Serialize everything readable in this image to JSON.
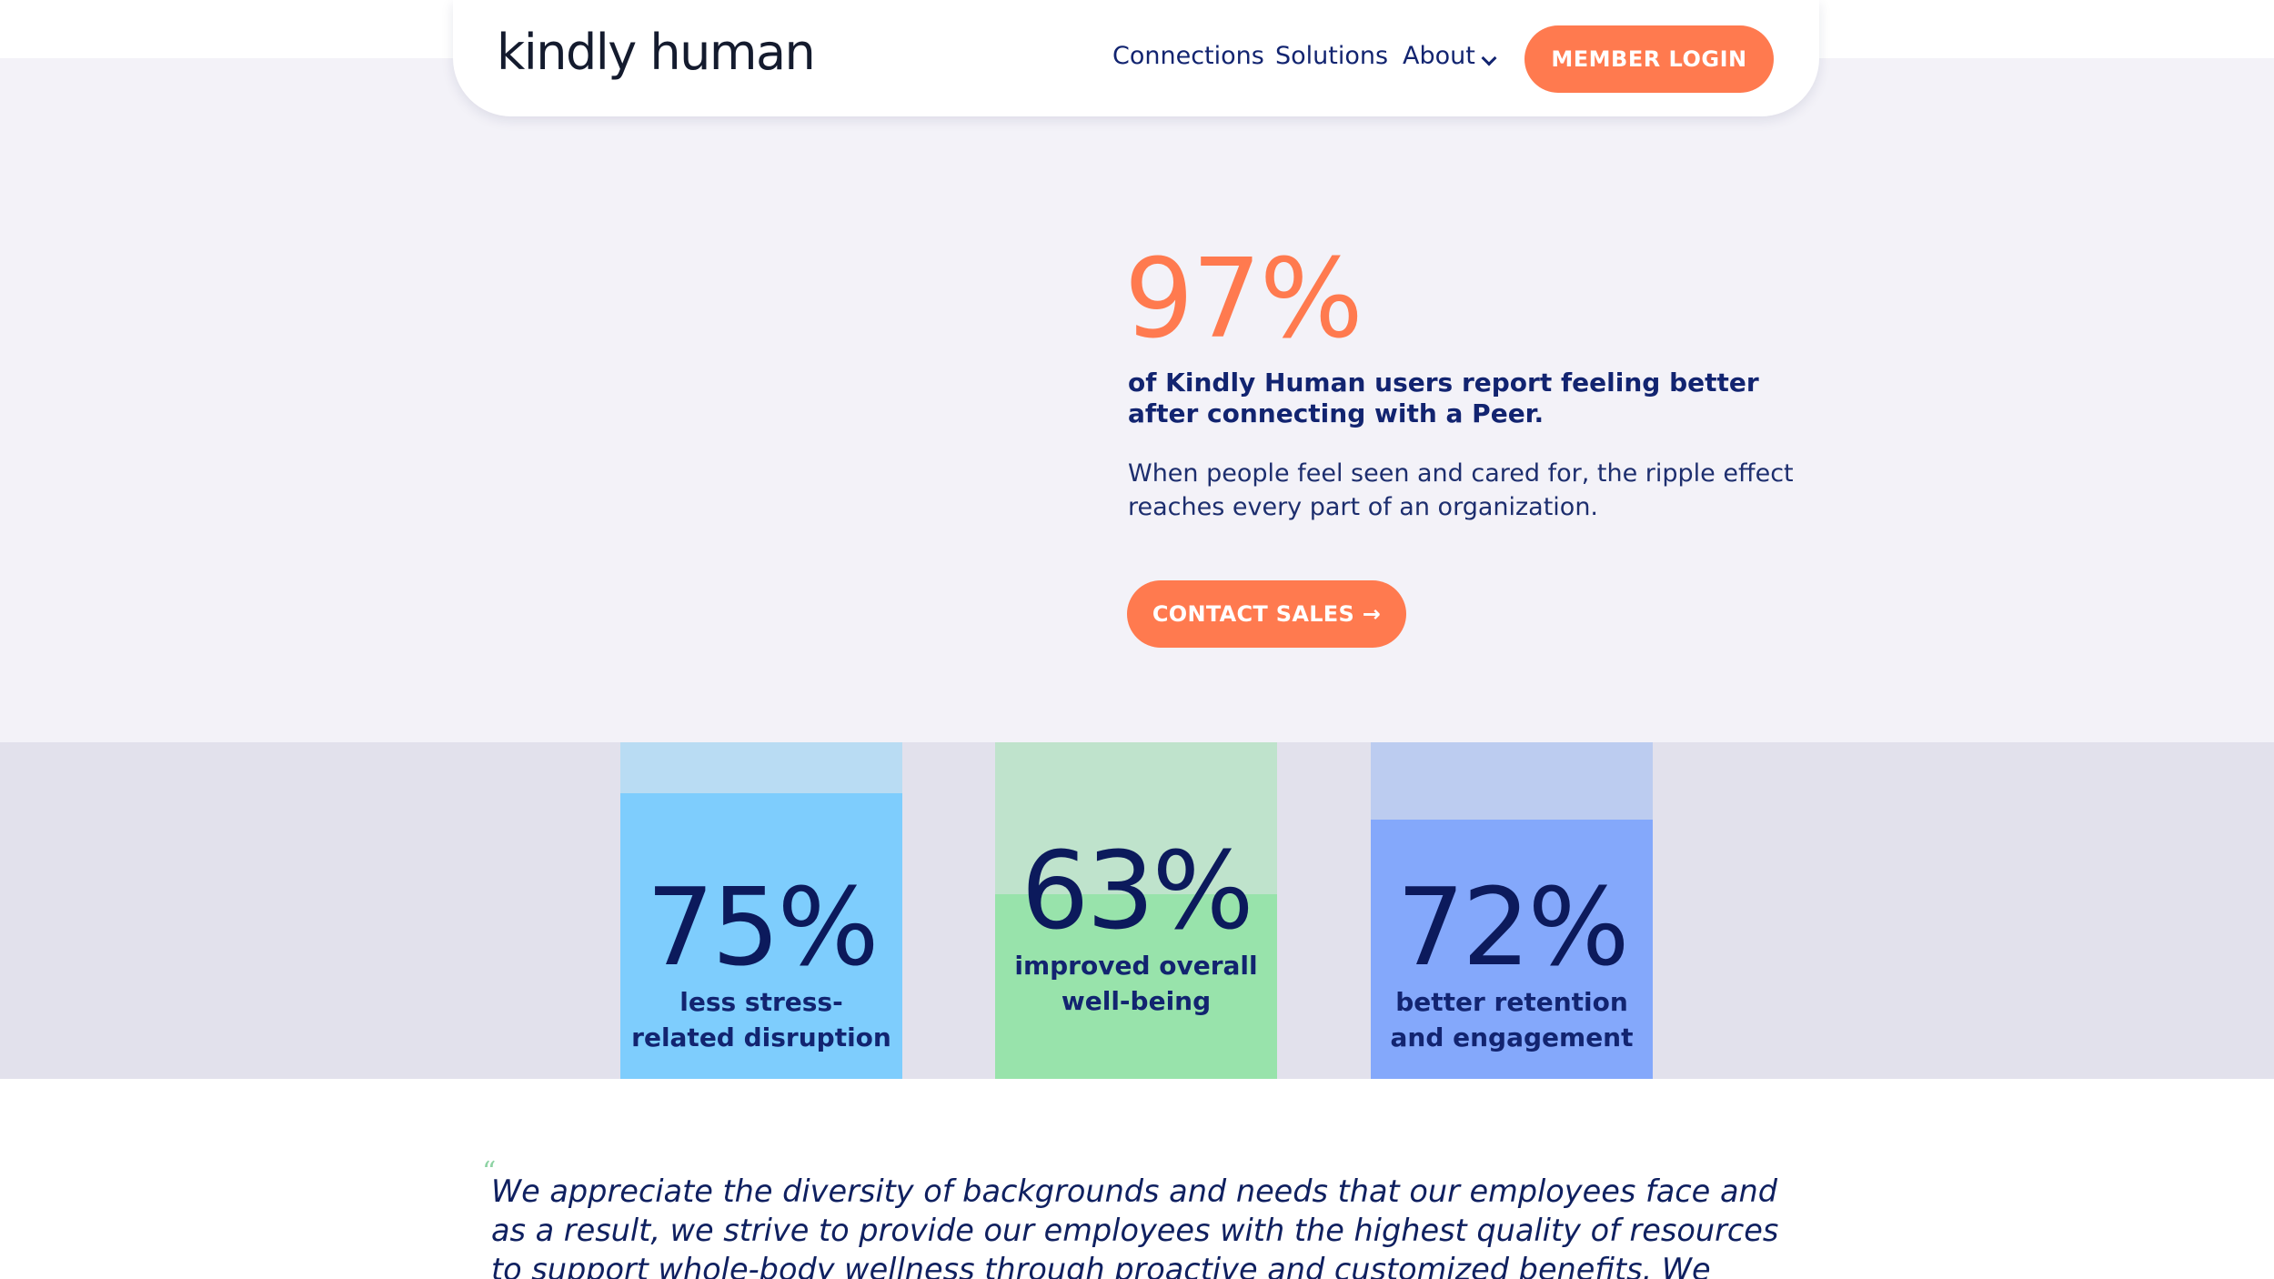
{
  "nav": {
    "logo_text": "kindly human",
    "links": [
      "Connections",
      "Solutions",
      "About"
    ],
    "about_icon": "chevron-down-icon",
    "login_label": "MEMBER LOGIN"
  },
  "hero": {
    "stat": "97%",
    "headline": "of Kindly Human users report feeling better after connecting with a Peer.",
    "body": "When people feel seen and cared for, the ripple effect reaches every part of an organization.",
    "cta_label": "CONTACT SALES →"
  },
  "stats": [
    {
      "value": "75%",
      "label": "less stress-related disruption",
      "percent": 75
    },
    {
      "value": "63%",
      "label": "improved overall well-being",
      "percent": 63
    },
    {
      "value": "72%",
      "label": "better retention and engagement",
      "percent": 72
    }
  ],
  "quote": {
    "mark": "“",
    "text": "We appreciate the diversity of backgrounds and needs that our employees face and as a result, we strive to provide our employees with the highest quality of resources to support whole-body wellness through proactive and customized benefits. We proudly"
  },
  "colors": {
    "accent": "#ff7a4f",
    "navy": "#122470",
    "hero_bg": "#f3f2f8",
    "band_bg": "#e2e1ec",
    "card1_top": "#b9dcf3",
    "card1_fill": "#7ecdfd",
    "card2_top": "#bfe3cc",
    "card2_fill": "#98e3ab",
    "card3_top": "#bcccf0",
    "card3_fill": "#84a8fb"
  }
}
